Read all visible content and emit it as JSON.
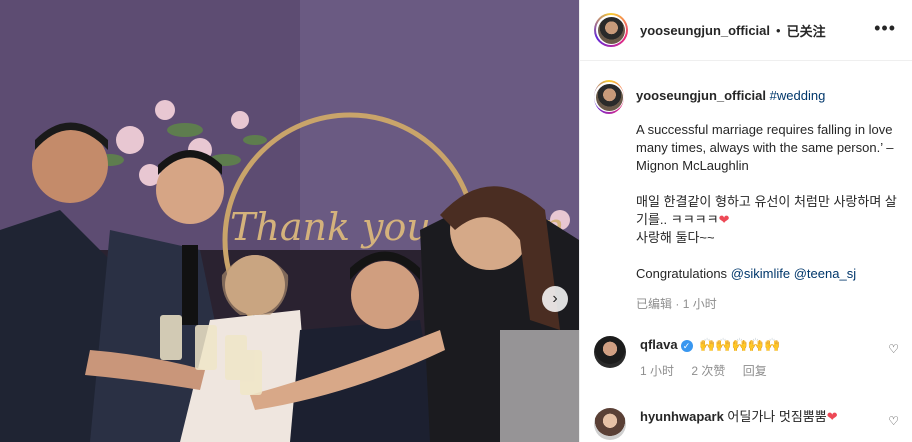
{
  "post": {
    "username": "yooseungjun_official",
    "follow_status": "已关注",
    "more_icon": "more-horizontal-icon",
    "photo_text": "Thank you Simon",
    "next_icon": "chevron-right-icon"
  },
  "caption": {
    "username": "yooseungjun_official",
    "hashtag": "#wedding",
    "quote": "A successful marriage requires falling in love many times, always with the same person.’ – Mignon McLaughlin",
    "korean_line1": "매일 한결같이 형하고 유선이 처럼만 사랑하며 살기를.. ㅋㅋㅋㅋ",
    "korean_line2": "사랑해 둘다~~",
    "congrats": "Congratulations",
    "mention1": "@sikimlife",
    "mention2": "@teena_sj",
    "edited": "已编辑",
    "time": "1 小时",
    "heart": "❤"
  },
  "comments": [
    {
      "username": "qflava",
      "verified": true,
      "text": "🙌🙌🙌🙌🙌",
      "time": "1 小时",
      "likes": "2 次赞",
      "reply": "回复"
    },
    {
      "username": "hyunhwapark",
      "text": "어딜가나 멋짐뿜뿜",
      "heart": "❤"
    }
  ],
  "colors": {
    "link": "#00376b",
    "verified": "#3897f0",
    "heart": "#ed4956"
  }
}
